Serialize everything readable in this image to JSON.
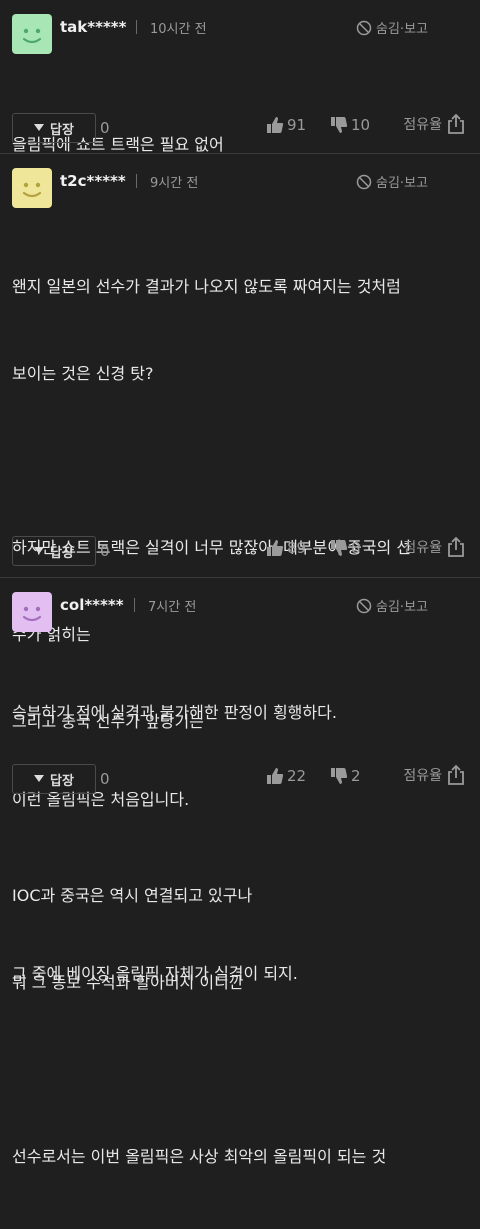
{
  "comments": [
    {
      "nickname": "tak*****",
      "time": "10시간 전",
      "hide_report": "숨김·보고",
      "avatar_color": "#a8e6b5",
      "lines": [
        "올림픽에 쇼트 트랙은 필요 없어"
      ],
      "reply_label": "답장",
      "reply_count": "0",
      "likes": "91",
      "dislikes": "10",
      "report_label": "점유율"
    },
    {
      "nickname": "t2c*****",
      "time": "9시간 전",
      "hide_report": "숨김·보고",
      "avatar_color": "#f0e69a",
      "lines": [
        "왠지 일본의 선수가 결과가 나오지 않도록 짜여지는 것처럼",
        "보이는 것은 신경 탓?",
        "",
        "하지만 쇼트 트랙은 실격이 너무 많잖아, 대부분이 중국의 선",
        "수가 얽히는",
        "그리고 중국 선수가 앞당기는",
        "",
        "IOC과 중국은 역시 연결되고 있구나",
        "뭐 그 똥보 수석과 할아버지 이니깐",
        "",
        "선수로서는 이번 올림픽은 사상 최악의 올림픽이 되는 것"
      ],
      "reply_label": "답장",
      "reply_count": "0",
      "likes": "89",
      "dislikes": "8",
      "report_label": "점유율"
    },
    {
      "nickname": "col*****",
      "time": "7시간 전",
      "hide_report": "숨김·보고",
      "avatar_color": "#e2bff0",
      "lines": [
        "승부하기 전에 실격과 불가해한 판정이 횡행하다.",
        "이런 올림픽은 처음입니다.",
        "",
        "그 중에 베이징 올림픽 자체가 실격이 되지."
      ],
      "reply_label": "답장",
      "reply_count": "0",
      "likes": "22",
      "dislikes": "2",
      "report_label": "점유율"
    }
  ]
}
